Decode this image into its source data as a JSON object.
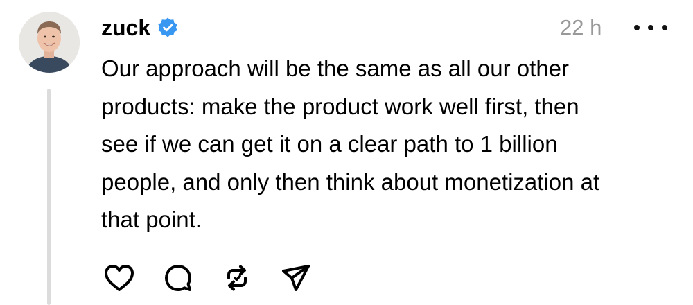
{
  "post": {
    "author": {
      "username": "zuck",
      "verified": true,
      "verified_color": "#3897f0",
      "avatar": "profile-photo"
    },
    "timestamp": "22 h",
    "more_icon": "ellipsis-icon",
    "text": "Our approach will be the same as all our other\nproducts: make the product work well first, then\nsee if we can get it on a clear path to 1 billion\npeople, and only then think about monetization at\nthat point.",
    "actions": [
      {
        "name": "like",
        "icon": "heart-icon"
      },
      {
        "name": "reply",
        "icon": "comment-icon"
      },
      {
        "name": "repost",
        "icon": "repost-icon"
      },
      {
        "name": "share",
        "icon": "send-icon"
      }
    ]
  },
  "colors": {
    "text": "#000000",
    "muted": "#999999",
    "thread_line": "#dcdcdc"
  }
}
